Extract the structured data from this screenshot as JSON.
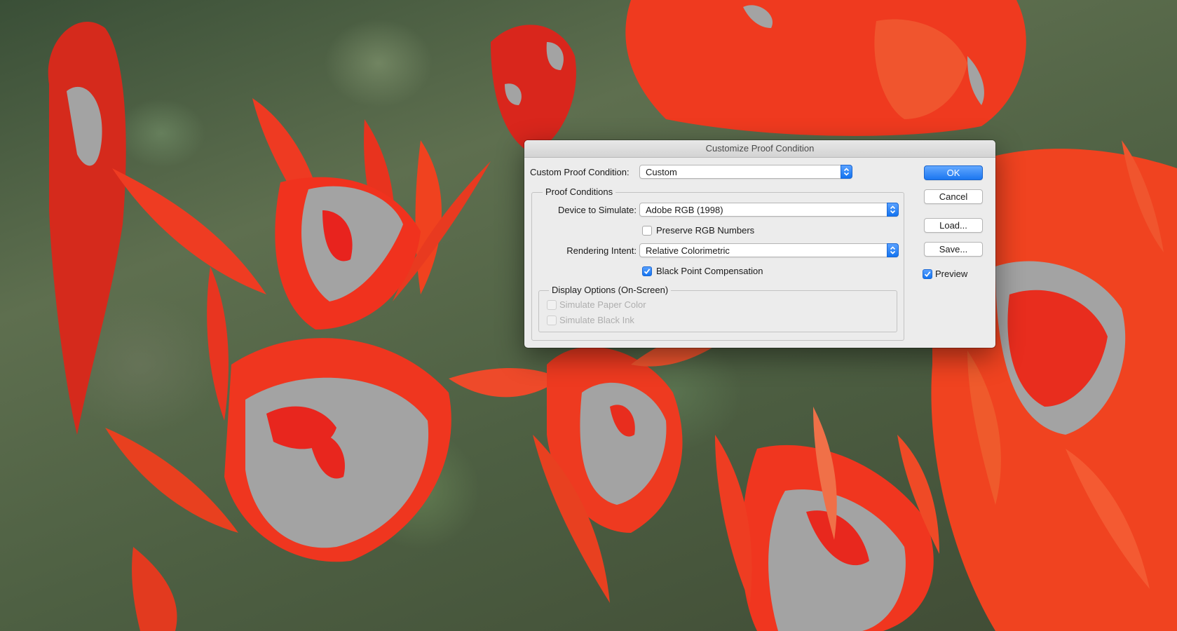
{
  "dialog": {
    "title": "Customize Proof Condition",
    "custom_proof_condition": {
      "label": "Custom Proof Condition:",
      "value": "Custom"
    },
    "proof_conditions": {
      "title": "Proof Conditions",
      "device_to_simulate": {
        "label": "Device to Simulate:",
        "value": "Adobe RGB (1998)"
      },
      "preserve_rgb_numbers": {
        "label": "Preserve RGB Numbers",
        "checked": false
      },
      "rendering_intent": {
        "label": "Rendering Intent:",
        "value": "Relative Colorimetric"
      },
      "black_point_compensation": {
        "label": "Black Point Compensation",
        "checked": true
      }
    },
    "display_options": {
      "title": "Display Options (On-Screen)",
      "simulate_paper_color": {
        "label": "Simulate Paper Color",
        "checked": false,
        "enabled": false
      },
      "simulate_black_ink": {
        "label": "Simulate Black Ink",
        "checked": false,
        "enabled": false
      }
    },
    "buttons": {
      "ok": "OK",
      "cancel": "Cancel",
      "load": "Load...",
      "save": "Save..."
    },
    "preview": {
      "label": "Preview",
      "checked": true
    }
  },
  "colors": {
    "accent": "#1b76f0",
    "flower_red": "#f0321e",
    "gamut_warning_gray": "#a3a3a3"
  }
}
